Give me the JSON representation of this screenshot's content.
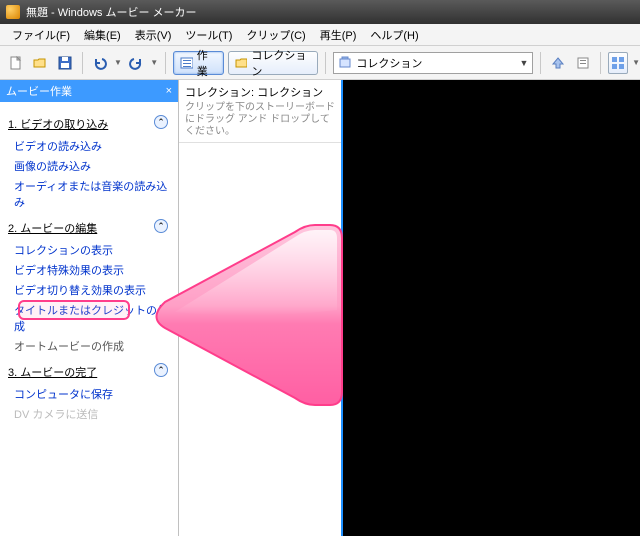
{
  "window": {
    "title": "無題 - Windows ムービー メーカー"
  },
  "menu": {
    "file": "ファイル(F)",
    "edit": "編集(E)",
    "view": "表示(V)",
    "tools": "ツール(T)",
    "clip": "クリップ(C)",
    "play": "再生(P)",
    "help": "ヘルプ(H)"
  },
  "toolbar": {
    "task_label": "作業",
    "collection_label": "コレクション",
    "collection_selected": "コレクション"
  },
  "taskpane": {
    "title": "ムービー作業",
    "close": "×",
    "section1": {
      "title": "1. ビデオの取り込み",
      "items": {
        "a": "ビデオの読み込み",
        "b": "画像の読み込み",
        "c": "オーディオまたは音楽の読み込み"
      }
    },
    "section2": {
      "title": "2. ムービーの編集",
      "items": {
        "a": "コレクションの表示",
        "b": "ビデオ特殊効果の表示",
        "c": "ビデオ切り替え効果の表示",
        "d": "タイトルまたはクレジットの作成",
        "e": "オートムービーの作成"
      }
    },
    "section3": {
      "title": "3. ムービーの完了",
      "items": {
        "a": "コンピュータに保存",
        "b": "DV カメラに送信"
      }
    }
  },
  "collection": {
    "heading": "コレクション: コレクション",
    "hint": "クリップを下のストーリーボードにドラッグ アンド ドロップしてください。"
  },
  "annotation": {
    "color_border": "#ff3d8b",
    "arrow_fill": "#ff8bbd"
  }
}
